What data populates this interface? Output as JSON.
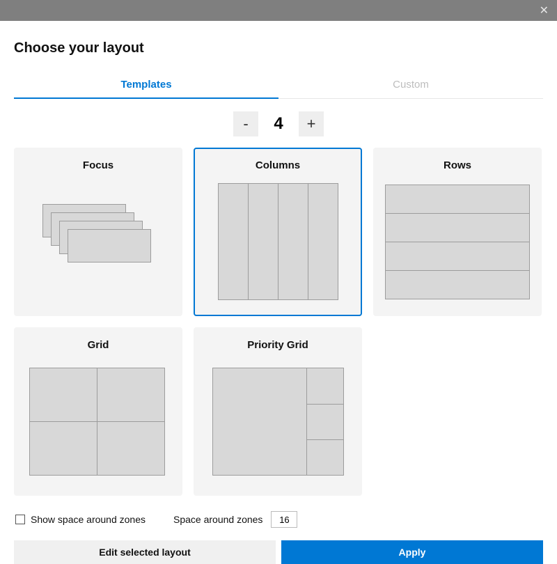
{
  "title": "Choose your layout",
  "tabs": {
    "templates": "Templates",
    "custom": "Custom",
    "active": "templates"
  },
  "counter": {
    "decrement": "-",
    "value": "4",
    "increment": "+"
  },
  "templates": {
    "focus": "Focus",
    "columns": "Columns",
    "rows": "Rows",
    "grid": "Grid",
    "priority_grid": "Priority Grid",
    "selected": "columns"
  },
  "options": {
    "show_space_label": "Show space around zones",
    "show_space_checked": false,
    "space_label": "Space around zones",
    "space_value": "16"
  },
  "actions": {
    "edit": "Edit selected layout",
    "apply": "Apply"
  }
}
